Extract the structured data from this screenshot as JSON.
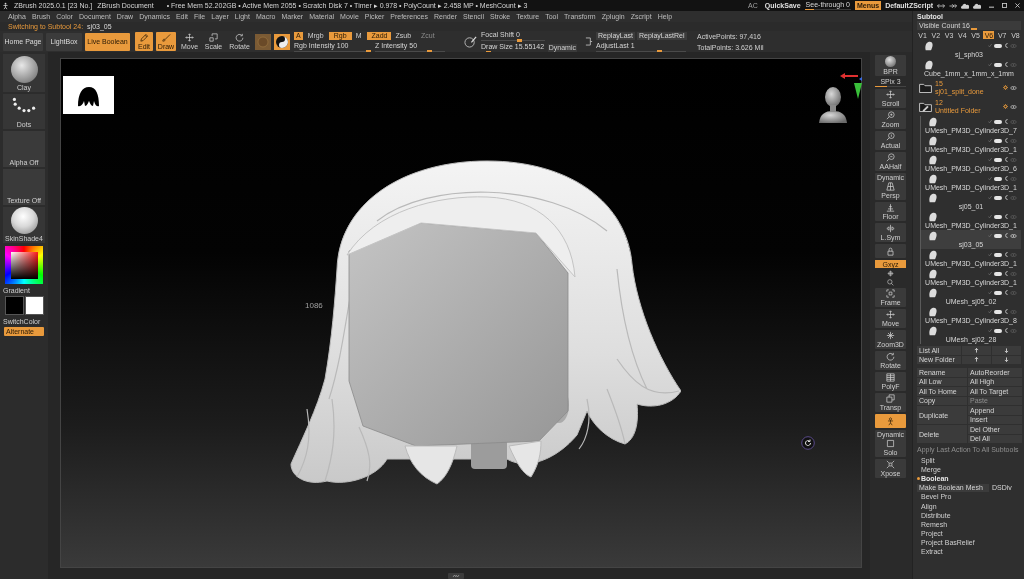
{
  "title_bar": {
    "app": "ZBrush 2025.0.1 [23 No.]",
    "document": "ZBrush Document",
    "stats": "• Free Mem 52.202GB • Active Mem 2055 • Scratch Disk 7 • Timer ▸ 0.978 • PolyCount ▸ 2.458 MP • MeshCount ▸ 3",
    "controls": [
      {
        "kind": "text",
        "label": "AC"
      },
      {
        "kind": "button",
        "label": "QuickSave"
      },
      {
        "kind": "slider",
        "label": "See-through",
        "value": "0",
        "level": 0.2
      },
      {
        "kind": "toggle",
        "label": "Menus",
        "on": true
      },
      {
        "kind": "button",
        "label": "DefaultZScript"
      }
    ]
  },
  "menu": [
    "Alpha",
    "Brush",
    "Color",
    "Document",
    "Draw",
    "Dynamics",
    "Edit",
    "File",
    "Layer",
    "Light",
    "Macro",
    "Marker",
    "Material",
    "Movie",
    "Picker",
    "Preferences",
    "Render",
    "Stencil",
    "Stroke",
    "Texture",
    "Tool",
    "Transform",
    "Zplugin",
    "Zscript",
    "Help"
  ],
  "notice": {
    "text": "Switching to Subtool 24:",
    "target": "sj03_05"
  },
  "toolbar": {
    "nav": [
      {
        "label": "Home Page"
      },
      {
        "label": "LightBox"
      }
    ],
    "live_boolean": {
      "label": "Live Boolean",
      "on": true
    },
    "modes": [
      {
        "kind": "edit",
        "label": "Edit",
        "on": true
      },
      {
        "kind": "draw",
        "label": "Draw",
        "on": true
      },
      {
        "kind": "move",
        "label": "Move",
        "on": false
      },
      {
        "kind": "scale",
        "label": "Scale",
        "on": false
      },
      {
        "kind": "rotate",
        "label": "Rotate",
        "on": false
      }
    ],
    "channels": [
      {
        "label": "A",
        "on": true
      },
      {
        "label": "Mrgb",
        "on": false
      },
      {
        "label": "Rgb",
        "on": true
      },
      {
        "label": "M",
        "on": false
      }
    ],
    "depth_modes": [
      {
        "label": "Zadd",
        "on": true,
        "disabled": false
      },
      {
        "label": "Zsub",
        "on": false,
        "disabled": false
      },
      {
        "label": "Zcut",
        "on": false,
        "disabled": true
      }
    ],
    "intensity": [
      {
        "label": "Rgb Intensity",
        "value": "100",
        "level": 0.98
      },
      {
        "label": "Z Intensity",
        "value": "50",
        "level": 0.78
      }
    ],
    "focal_shift": {
      "label": "Focal Shift",
      "value": "0",
      "level": 0.6
    },
    "draw_size": {
      "label": "Draw Size",
      "value": "15.55142",
      "level": 0.12
    },
    "dynamic": {
      "label": "Dynamic",
      "on": false
    },
    "replay": [
      {
        "label": "ReplayLast"
      },
      {
        "label": "ReplayLastRel"
      }
    ],
    "adjust_last": {
      "label": "AdjustLast",
      "value": "1",
      "level": 0.7
    },
    "stats": [
      "ActivePoints: 97,416",
      "TotalPoints: 3.626 Mil"
    ]
  },
  "left_panel": {
    "brush": "Clay",
    "stroke": "Dots",
    "alpha": "Alpha Off",
    "texture": "Texture Off",
    "material": "SkinShade4",
    "gradient": "Gradient",
    "swatches": [
      {
        "color": "#000000"
      },
      {
        "color": "#ffffff"
      }
    ],
    "switch_color": "SwitchColor",
    "alternate": {
      "label": "Alternate",
      "on": true
    }
  },
  "canvas": {
    "readout": "1086"
  },
  "shelf": [
    {
      "kind": "sphere",
      "label": "BPR",
      "on": false
    },
    {
      "kind": "slider",
      "label": "SPix 3",
      "level": 0.4
    },
    {
      "kind": "scroll",
      "label": "Scroll",
      "on": false
    },
    {
      "kind": "zoom",
      "label": "Zoom",
      "on": false
    },
    {
      "kind": "actual",
      "label": "Actual",
      "on": false
    },
    {
      "kind": "half",
      "label": "AAHalf",
      "on": false
    },
    {
      "kind": "persp",
      "caption": "Dynamic",
      "label": "Persp",
      "on": false
    },
    {
      "kind": "floor",
      "label": "Floor",
      "on": false
    },
    {
      "kind": "lsym",
      "label": "L.Sym",
      "on": false
    },
    {
      "kind": "lock",
      "on": false
    },
    {
      "kind": "tag",
      "label": "Gxyz",
      "on": true
    },
    {
      "kind": "crosshair",
      "on": false
    },
    {
      "kind": "search",
      "on": false
    },
    {
      "kind": "frame",
      "label": "Frame",
      "on": false
    },
    {
      "kind": "move",
      "label": "Move",
      "on": false
    },
    {
      "kind": "zoom3d",
      "label": "Zoom3D",
      "on": false
    },
    {
      "kind": "rotate",
      "label": "Rotate",
      "on": false
    },
    {
      "kind": "polyf",
      "label": "PolyF",
      "on": false
    },
    {
      "kind": "transp",
      "label": "Transp",
      "on": false
    },
    {
      "kind": "figure",
      "on": true
    },
    {
      "kind": "solo",
      "caption": "Dynamic",
      "label": "Solo",
      "on": false
    },
    {
      "kind": "xpose",
      "label": "Xpose",
      "on": false
    }
  ],
  "subtool": {
    "title": "Subtool",
    "visible_count": {
      "label": "Visible Count",
      "value": "16",
      "level": 0.55
    },
    "versions": [
      {
        "label": "V1",
        "selected": false
      },
      {
        "label": "V2",
        "selected": false
      },
      {
        "label": "V3",
        "selected": false
      },
      {
        "label": "V4",
        "selected": false
      },
      {
        "label": "V5",
        "selected": false
      },
      {
        "label": "V6",
        "selected": true
      },
      {
        "label": "V7",
        "selected": false
      },
      {
        "label": "V8",
        "selected": false
      }
    ],
    "items": [
      {
        "kind": "mesh",
        "name": "sj_sph03",
        "selected": false
      },
      {
        "kind": "mesh",
        "name": "Cube_1mm_x_1mm_x_1mm",
        "selected": false
      },
      {
        "kind": "folder",
        "count": "15",
        "name": "sj01_split_done",
        "selected": false,
        "expanded": false
      },
      {
        "kind": "folder",
        "count": "12",
        "name": "Untitled Folder",
        "selected": false,
        "expanded": true,
        "children": [
          {
            "kind": "mesh",
            "name": "UMesh_PM3D_Cylinder3D_7",
            "selected": false
          },
          {
            "kind": "mesh",
            "name": "UMesh_PM3D_Cylinder3D_1",
            "selected": false
          },
          {
            "kind": "mesh",
            "name": "UMesh_PM3D_Cylinder3D_6",
            "selected": false
          },
          {
            "kind": "mesh",
            "name": "UMesh_PM3D_Cylinder3D_1",
            "selected": false
          },
          {
            "kind": "mesh",
            "name": "sj05_01",
            "selected": false
          },
          {
            "kind": "mesh",
            "name": "UMesh_PM3D_Cylinder3D_1",
            "selected": false
          },
          {
            "kind": "mesh",
            "name": "sj03_05",
            "selected": true
          },
          {
            "kind": "mesh",
            "name": "UMesh_PM3D_Cylinder3D_1",
            "selected": false
          },
          {
            "kind": "mesh",
            "name": "UMesh_PM3D_Cylinder3D_1",
            "selected": false
          },
          {
            "kind": "mesh",
            "name": "UMesh_sj05_02",
            "selected": false
          },
          {
            "kind": "mesh",
            "name": "UMesh_PM3D_Cylinder3D_8",
            "selected": false
          },
          {
            "kind": "mesh",
            "name": "UMesh_sj02_28",
            "selected": false
          }
        ]
      }
    ],
    "list_controls": [
      {
        "label": "List All"
      },
      {
        "label": "New Folder"
      }
    ],
    "actions": [
      {
        "left": {
          "label": "Rename",
          "disabled": false
        },
        "right": [
          {
            "label": "AutoReorder",
            "disabled": false
          }
        ]
      },
      {
        "left": {
          "label": "All Low",
          "disabled": false
        },
        "right": [
          {
            "label": "All High",
            "disabled": false
          }
        ]
      },
      {
        "left": {
          "label": "All To Home",
          "disabled": false
        },
        "right": [
          {
            "label": "All To Target",
            "disabled": false
          }
        ]
      },
      {
        "left": {
          "label": "Copy",
          "disabled": false
        },
        "right": [
          {
            "label": "Paste",
            "disabled": true
          }
        ]
      },
      {
        "left": {
          "label": "Duplicate",
          "disabled": false
        },
        "right": [
          {
            "label": "Append",
            "disabled": false
          },
          {
            "label": "Insert",
            "disabled": false
          }
        ]
      },
      {
        "left": {
          "label": "Delete",
          "disabled": false
        },
        "right": [
          {
            "label": "Del Other",
            "disabled": false
          },
          {
            "label": "Del All",
            "disabled": false
          }
        ]
      }
    ],
    "apply_all": {
      "label": "Apply Last Action To All Subtools",
      "disabled": true
    },
    "sections": [
      {
        "label": "Split",
        "expanded": false
      },
      {
        "label": "Merge",
        "expanded": false
      },
      {
        "label": "Boolean",
        "expanded": true,
        "buttons": [
          {
            "label": "Make Boolean Mesh"
          },
          {
            "label": "DSDiv"
          }
        ]
      },
      {
        "label": "Bevel Pro",
        "expanded": false
      },
      {
        "label": "Align",
        "expanded": false
      },
      {
        "label": "Distribute",
        "expanded": false
      },
      {
        "label": "Remesh",
        "expanded": false
      },
      {
        "label": "Project",
        "expanded": false
      },
      {
        "label": "Project BasRelief",
        "expanded": false
      },
      {
        "label": "Extract",
        "expanded": false
      }
    ]
  }
}
